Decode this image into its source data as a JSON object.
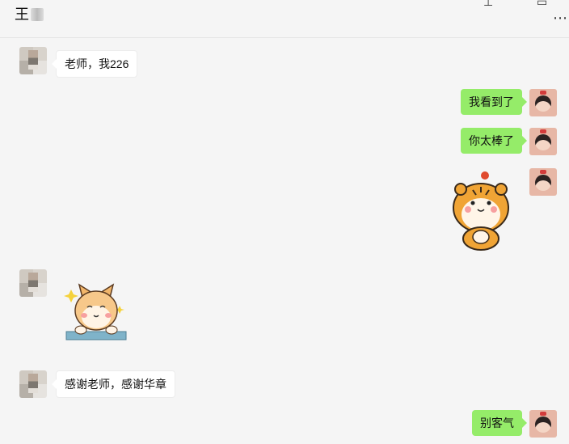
{
  "header": {
    "contact_name": "王",
    "pin_icon": "pin-icon",
    "window_icon": "window-icon",
    "more_icon": "more-icon"
  },
  "messages": [
    {
      "side": "left",
      "type": "text",
      "text": "老师，我226"
    },
    {
      "side": "right",
      "type": "text",
      "text": "我看到了"
    },
    {
      "side": "right",
      "type": "text",
      "text": "你太棒了"
    },
    {
      "side": "right",
      "type": "sticker",
      "sticker": "tiger-sticker"
    },
    {
      "side": "left",
      "type": "sticker",
      "sticker": "cat-sticker"
    },
    {
      "side": "left",
      "type": "text",
      "text": "感谢老师，感谢华章"
    },
    {
      "side": "right",
      "type": "text",
      "text": "别客气"
    }
  ],
  "colors": {
    "background": "#f5f5f5",
    "incoming_bubble": "#ffffff",
    "outgoing_bubble": "#95ec69"
  }
}
